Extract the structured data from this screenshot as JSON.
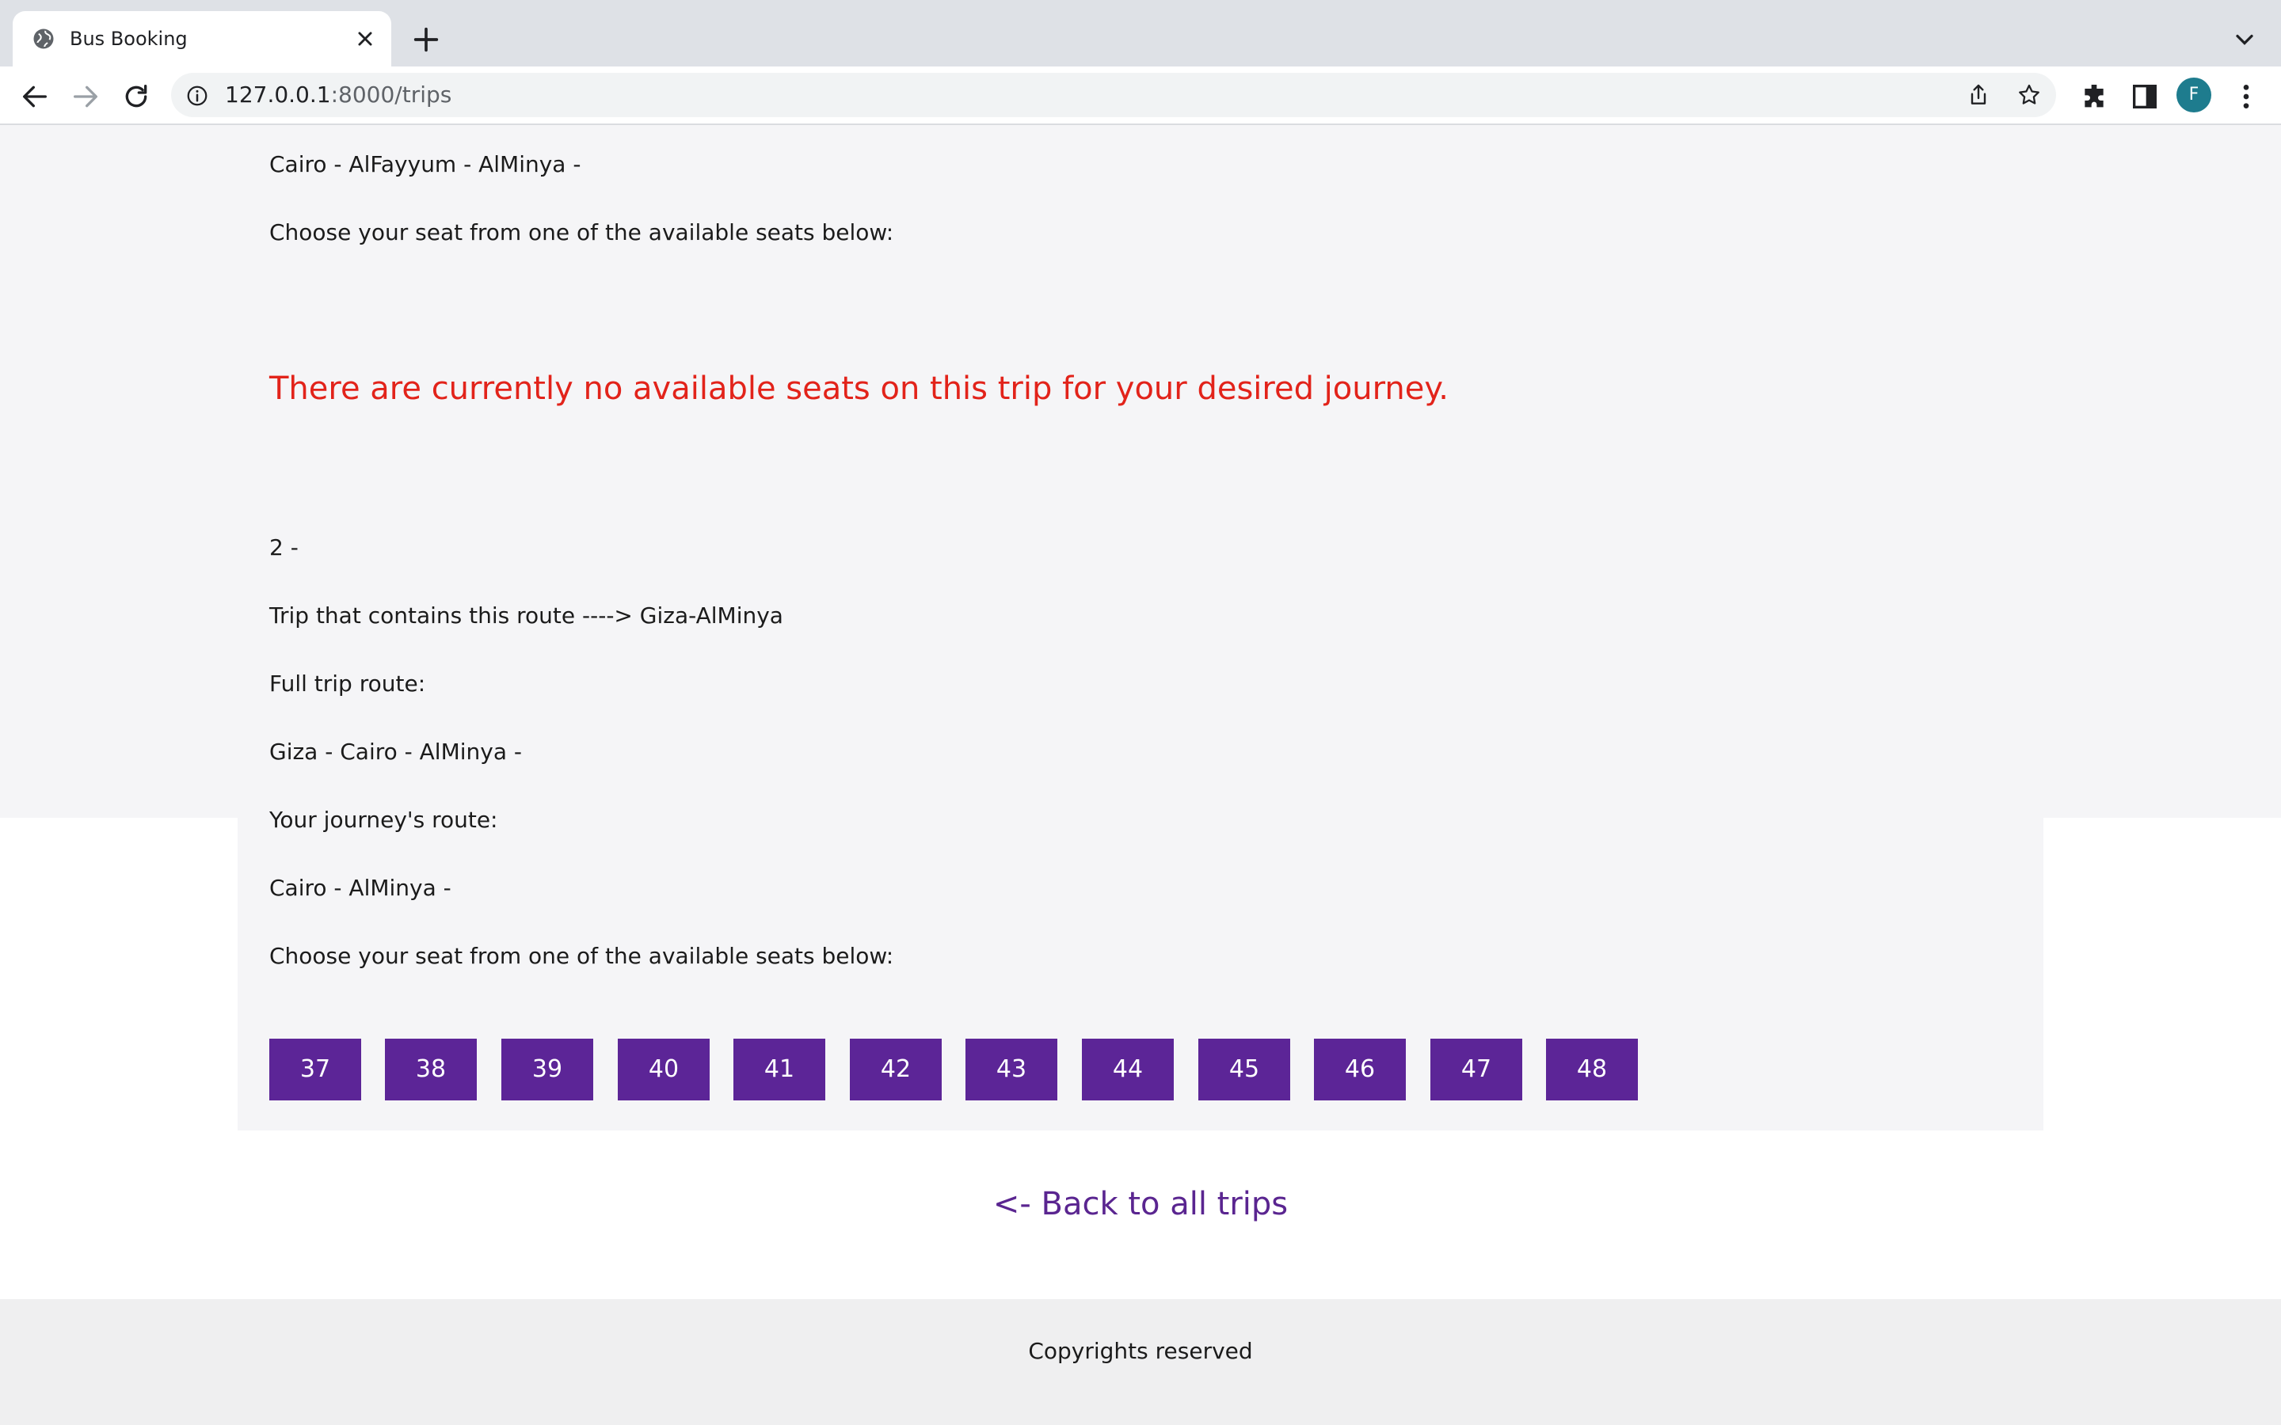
{
  "browser": {
    "tab_title": "Bus Booking",
    "url_host": "127.0.0.1",
    "url_path": ":8000/trips",
    "profile_initial": "F"
  },
  "trip1": {
    "journey_route": "Cairo - AlFayyum - AlMinya -",
    "choose_prompt": "Choose your seat from one of the available seats below:",
    "no_seats_message": "There are currently no available seats on this trip for your desired journey."
  },
  "trip2": {
    "index": "2 -",
    "contains_route": "Trip that contains this route ----> Giza-AlMinya",
    "full_route_label": "Full trip route:",
    "full_route": "Giza - Cairo - AlMinya -",
    "journey_label": "Your journey's route:",
    "journey_route": "Cairo - AlMinya -",
    "choose_prompt": "Choose your seat from one of the available seats below:",
    "seats": [
      "37",
      "38",
      "39",
      "40",
      "41",
      "42",
      "43",
      "44",
      "45",
      "46",
      "47",
      "48"
    ]
  },
  "back_link": "<- Back to all trips",
  "footer": "Copyrights reserved",
  "colors": {
    "seat_button": "#5c2597",
    "warning_text": "#e2231a",
    "link": "#5a2590"
  }
}
